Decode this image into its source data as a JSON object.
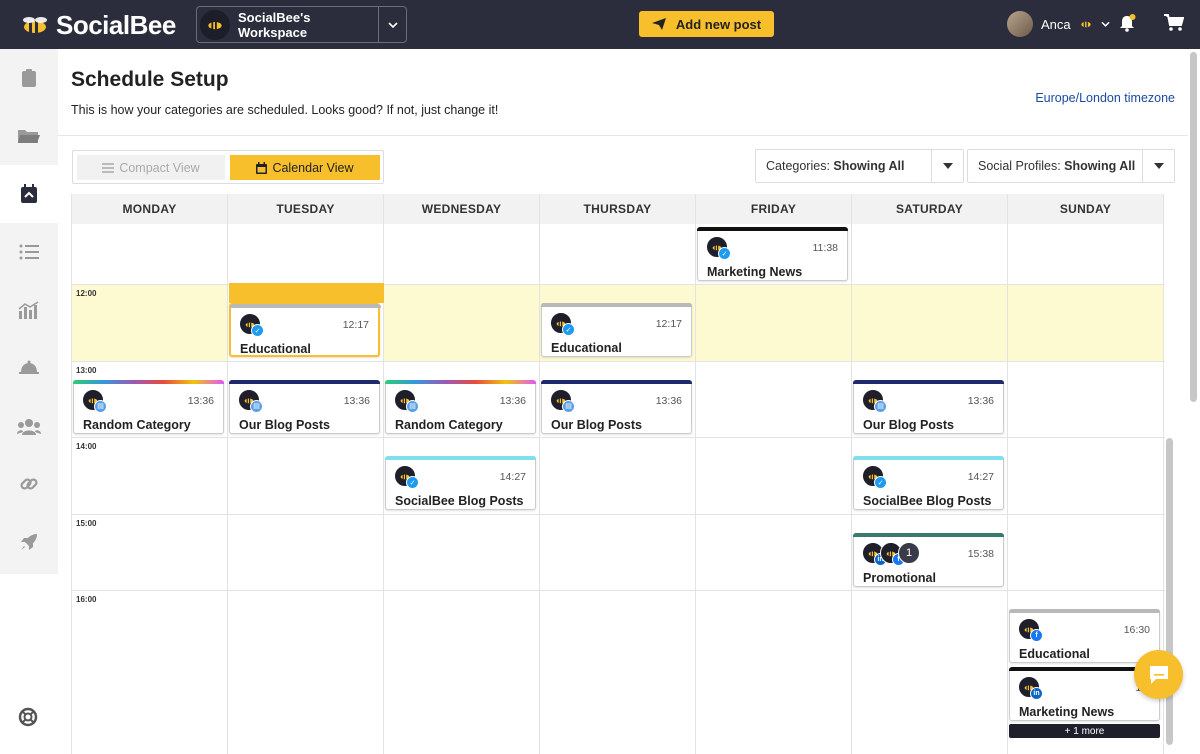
{
  "app": {
    "brand": "SocialBee"
  },
  "header": {
    "workspace": "SocialBee's Workspace",
    "add_post": "Add new post",
    "user_name": "Anca"
  },
  "sidebar": {
    "items": [
      {
        "icon": "clipboard-icon"
      },
      {
        "icon": "folder-icon"
      },
      {
        "icon": "calendar-icon",
        "active": true
      },
      {
        "icon": "list-icon"
      },
      {
        "icon": "analytics-icon"
      },
      {
        "icon": "cloche-icon"
      },
      {
        "icon": "team-icon"
      },
      {
        "icon": "link-icon"
      },
      {
        "icon": "rocket-icon"
      }
    ]
  },
  "page": {
    "title": "Schedule Setup",
    "subtitle": "This is how your categories are scheduled. Looks good? If not, just change it!",
    "timezone": "Europe/London timezone",
    "compact_view": "Compact View",
    "calendar_view": "Calendar View",
    "categories_label": "Categories:",
    "categories_value": "Showing All",
    "profiles_label": "Social Profiles:",
    "profiles_value": "Showing All"
  },
  "calendar": {
    "days": [
      "MONDAY",
      "TUESDAY",
      "WEDNESDAY",
      "THURSDAY",
      "FRIDAY",
      "SATURDAY",
      "SUNDAY"
    ],
    "hours": [
      "12:00",
      "13:00",
      "14:00",
      "15:00",
      "16:00"
    ],
    "more_label": "+ 1 more",
    "cards": [
      {
        "day": 4,
        "time": "11:38",
        "category": "Marketing News",
        "color": "#111111",
        "net": "tw"
      },
      {
        "day": 1,
        "time": "12:17",
        "category": "Educational",
        "color": "#b9b9b9",
        "net": "tw",
        "selected": true
      },
      {
        "day": 3,
        "time": "12:17",
        "category": "Educational",
        "color": "#b9b9b9",
        "net": "tw"
      },
      {
        "day": 0,
        "time": "13:36",
        "category": "Random Category",
        "color": "rainbow",
        "net": "bl"
      },
      {
        "day": 1,
        "time": "13:36",
        "category": "Our Blog Posts",
        "color": "#1f2a6e",
        "net": "bl"
      },
      {
        "day": 2,
        "time": "13:36",
        "category": "Random Category",
        "color": "rainbow",
        "net": "bl"
      },
      {
        "day": 3,
        "time": "13:36",
        "category": "Our Blog Posts",
        "color": "#1f2a6e",
        "net": "bl"
      },
      {
        "day": 5,
        "time": "13:36",
        "category": "Our Blog Posts",
        "color": "#1f2a6e",
        "net": "bl"
      },
      {
        "day": 2,
        "time": "14:27",
        "category": "SocialBee Blog Posts",
        "color": "#7fe0ec",
        "net": "tw"
      },
      {
        "day": 5,
        "time": "14:27",
        "category": "SocialBee Blog Posts",
        "color": "#7fe0ec",
        "net": "tw"
      },
      {
        "day": 5,
        "time": "15:38",
        "category": "Promotional",
        "color": "#3a7a6e",
        "net": "multi",
        "extra": "1"
      },
      {
        "day": 6,
        "time": "16:30",
        "category": "Educational",
        "color": "#b9b9b9",
        "net": "fb"
      },
      {
        "day": 6,
        "time": "16:",
        "category": "Marketing News",
        "color": "#111111",
        "net": "li"
      }
    ]
  },
  "colors": {
    "accent": "#f7bf2c",
    "topbar": "#2b2d3c",
    "highlight": "#fdfad2"
  }
}
